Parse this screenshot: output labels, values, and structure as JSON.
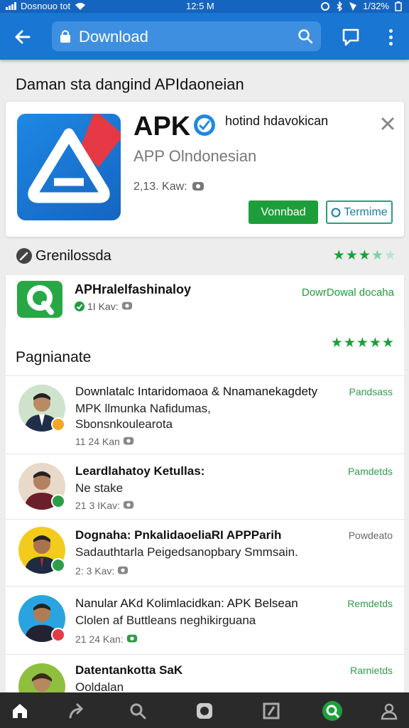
{
  "status_bar": {
    "carrier": "Dosnouo tot",
    "time": "12:5 M",
    "battery": "1/32%"
  },
  "toolbar": {
    "search_text": "Download"
  },
  "heading": "Daman sta dangind APIdaoneian",
  "hero": {
    "title": "APK",
    "developer": "hotind hdavokican",
    "subtitle": "APP Olndonesian",
    "size": "2,13. Kaw:",
    "download_label": "Vonnbad",
    "secondary_label": "Termime"
  },
  "section": {
    "label": "Grenilossda",
    "rating_stars": 3.5
  },
  "app_row": {
    "name": "APHralelfashinaloy",
    "meta": "1I Kav:",
    "download_label": "DowrDowal docaha"
  },
  "comments": {
    "title": "Pagnianate",
    "rating_stars": 5,
    "items": [
      {
        "line1": "Downlatalc Intaridomaoa & Nnamanekagdety",
        "line2": "MPK llmunka Nafidumas,",
        "line3": "Sbonsnkoulearota",
        "meta": "11 24 Kan",
        "tag": "Pandsass",
        "tag_color": "#2e9d4a",
        "dot_color": "#f5a623"
      },
      {
        "line1": "Leardlahatoy Ketullas:",
        "line2": "Ne stake",
        "meta": "21 3 IKav:",
        "tag": "Pamdetds",
        "tag_color": "#2e9d4a",
        "dot_color": "#2e9d4a"
      },
      {
        "line1": "Dognaha: PnkalidaoeliaRI APPParih",
        "line2": "Sadauthtarla Peigedsanopbary Smmsain.",
        "meta": "2: 3 Kav:",
        "tag": "Powdeato",
        "tag_color": "#666666",
        "dot_color": "#2e9d4a"
      },
      {
        "line1": "Nanular AKd Kolimlacidkan: APK Belsean",
        "line2": "Clolen af Buttleans neghikirguana",
        "meta": "21 24 Kan:",
        "tag": "Remdetds",
        "tag_color": "#2e9d4a",
        "dot_color": "#e53946"
      },
      {
        "line1": "Datentankotta SaK",
        "line2": "Ooldalan",
        "tag": "Rarnietds",
        "tag_color": "#2e9d4a"
      }
    ]
  },
  "colors": {
    "app_bar": "#1976d2",
    "status_bar": "#1565c0",
    "accent_green": "#1e9e3a",
    "bottom_nav": "#2a2a2a"
  }
}
